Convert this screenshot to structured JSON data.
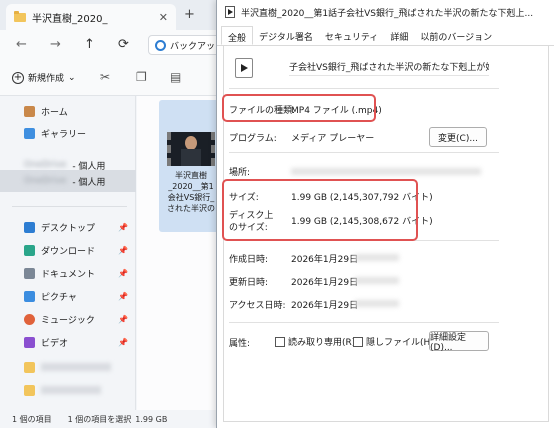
{
  "explorer": {
    "tab_title": "半沢直樹_2020_",
    "tab_close": "✕",
    "tab_new": "+",
    "nav": {
      "back": "←",
      "forward": "→",
      "up": "↑",
      "refresh": "⟳"
    },
    "address": "バックアップ",
    "commands": {
      "new_label": "新規作成",
      "new_chevron": "⌄"
    },
    "sidebar": {
      "items": [
        {
          "label": "ホーム"
        },
        {
          "label": "ギャラリー"
        },
        {
          "label": "- 個人用",
          "prefix": "OneDrive"
        },
        {
          "label": "- 個人用",
          "prefix": "OneDrive"
        },
        {
          "label": "デスクトップ"
        },
        {
          "label": "ダウンロード"
        },
        {
          "label": "ドキュメント"
        },
        {
          "label": "ピクチャ"
        },
        {
          "label": "ミュージック"
        },
        {
          "label": "ビデオ"
        }
      ],
      "pin": "📌"
    },
    "file": {
      "name_lines": [
        "半沢直樹",
        "_2020__第1",
        "会社VS銀行_",
        "された半沢の"
      ]
    },
    "status": {
      "count": "1 個の項目",
      "selected": "1 個の項目を選択",
      "size": "1.99 GB"
    }
  },
  "dialog": {
    "title": "半沢直樹_2020__第1話子会社VS銀行_飛ばされた半沢の新たな下剋上...",
    "tabs": [
      "全般",
      "デジタル署名",
      "セキュリティ",
      "詳細",
      "以前のバージョン"
    ],
    "file_name": "子会社VS銀行_飛ばされた半沢の新たな下剋上が始まる",
    "file_type_label": "ファイルの種類:",
    "file_type_value": "MP4 ファイル (.mp4)",
    "program_label": "プログラム:",
    "program_value": "メディア プレーヤー",
    "change_button": "変更(C)...",
    "location_label": "場所:",
    "size_label": "サイズ:",
    "size_value": "1.99 GB (2,145,307,792 バイト)",
    "disk_size_label": [
      "ディスク上",
      "のサイズ:"
    ],
    "disk_size_value": "1.99 GB (2,145,308,672 バイト)",
    "created_label": "作成日時:",
    "created_value": "2026年1月29日",
    "modified_label": "更新日時:",
    "modified_value": "2026年1月29日",
    "accessed_label": "アクセス日時:",
    "accessed_value": "2026年1月29日",
    "attributes_label": "属性:",
    "readonly_label": "読み取り専用(R)",
    "hidden_label": "隠しファイル(H)",
    "advanced_button": "詳細設定(D)..."
  },
  "colors": {
    "highlight": "#e05252",
    "selection": "#cfe0f3",
    "accent": "#2d7dd2"
  }
}
